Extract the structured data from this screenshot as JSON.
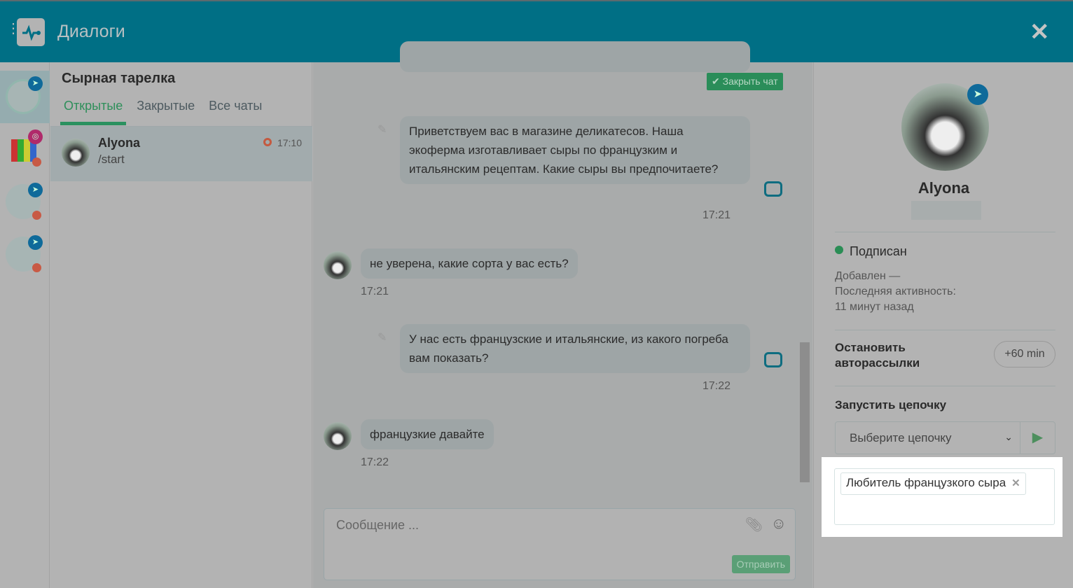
{
  "header": {
    "title": "Диалоги"
  },
  "list": {
    "title": "Сырная тарелка",
    "tabs": [
      "Открытые",
      "Закрытые",
      "Все чаты"
    ],
    "chats": [
      {
        "name": "Alyona",
        "last": "/start",
        "time": "17:10"
      }
    ]
  },
  "chat": {
    "close_chat": "Закрыть чат",
    "messages": [
      {
        "from": "bot",
        "text": "Приветствуем вас в магазине деликатесов. Наша экоферма изготавливает сыры по французким и итальянским рецептам. Какие сыры вы предпочитаете?",
        "time": "17:21"
      },
      {
        "from": "user",
        "text": "не уверена, какие сорта у вас есть?",
        "time": "17:21"
      },
      {
        "from": "bot",
        "text": "У нас есть французские и итальянские, из какого погреба вам показать?",
        "time": "17:22"
      },
      {
        "from": "user",
        "text": "французкие давайте",
        "time": "17:22"
      }
    ],
    "composer_placeholder": "Сообщение ...",
    "send": "Отправить"
  },
  "profile": {
    "name": "Alyona",
    "status": "Подписан",
    "added": "Добавлен —",
    "last_activity_label": "Последняя активность:",
    "last_activity": "11 минут назад",
    "stop_label": "Остановить авторассылки",
    "stop_button": "+60 min",
    "chain_label": "Запустить цепочку",
    "chain_select": "Выберите цепочку",
    "tags": [
      "Любитель французкого сыра"
    ]
  },
  "colors": {
    "header": "#006f85",
    "accent": "#2b9160"
  }
}
